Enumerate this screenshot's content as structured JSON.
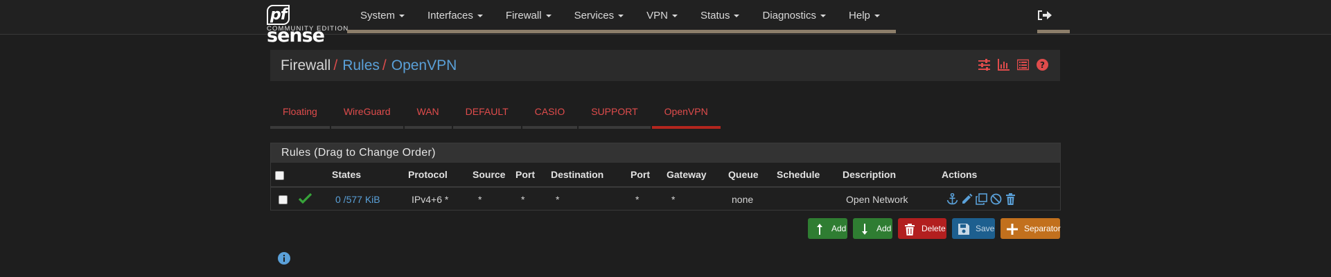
{
  "logo": {
    "mark_pf": "pf",
    "mark_sense": "sense",
    "subtitle": "COMMUNITY EDITION"
  },
  "nav": {
    "items": [
      {
        "label": "System"
      },
      {
        "label": "Interfaces"
      },
      {
        "label": "Firewall"
      },
      {
        "label": "Services"
      },
      {
        "label": "VPN"
      },
      {
        "label": "Status"
      },
      {
        "label": "Diagnostics"
      },
      {
        "label": "Help"
      }
    ],
    "logout_icon": "sign-out-icon"
  },
  "breadcrumb": {
    "root": "Firewall",
    "separator": "/",
    "level1": "Rules",
    "level2": "OpenVPN",
    "icons": [
      "sliders-icon",
      "bar-chart-icon",
      "list-icon",
      "help-circle-icon"
    ]
  },
  "tabs": [
    {
      "label": "Floating",
      "active": false
    },
    {
      "label": "WireGuard",
      "active": false
    },
    {
      "label": "WAN",
      "active": false
    },
    {
      "label": "DEFAULT",
      "active": false
    },
    {
      "label": "CASIO",
      "active": false
    },
    {
      "label": "SUPPORT",
      "active": false
    },
    {
      "label": "OpenVPN",
      "active": true
    }
  ],
  "rules": {
    "heading": "Rules (Drag to Change Order)",
    "columns": [
      "States",
      "Protocol",
      "Source",
      "Port",
      "Destination",
      "Port",
      "Gateway",
      "Queue",
      "Schedule",
      "Description",
      "Actions"
    ],
    "rows": [
      {
        "status_icon": "check-icon",
        "states": "0 /577 KiB",
        "protocol": "IPv4+6 *",
        "source": "*",
        "source_port": "*",
        "destination": "*",
        "destination_port": "*",
        "gateway": "*",
        "queue": "none",
        "schedule": "",
        "description": "Open Network",
        "actions": [
          "anchor-icon",
          "pencil-icon",
          "copy-icon",
          "ban-icon",
          "trash-icon"
        ]
      }
    ]
  },
  "buttons": {
    "add_top": "Add",
    "add_bottom": "Add",
    "delete": "Delete",
    "save": "Save",
    "separator": "Separator"
  },
  "colors": {
    "accent_red": "#e04c4c",
    "link_blue": "#5aa0d8",
    "nav_underline": "#8c7e6a",
    "active_tab": "#b3261e",
    "btn_green": "#2f7d32",
    "btn_red": "#b21f1f",
    "btn_blue": "#1d5f8f",
    "btn_orange": "#c2701d"
  }
}
